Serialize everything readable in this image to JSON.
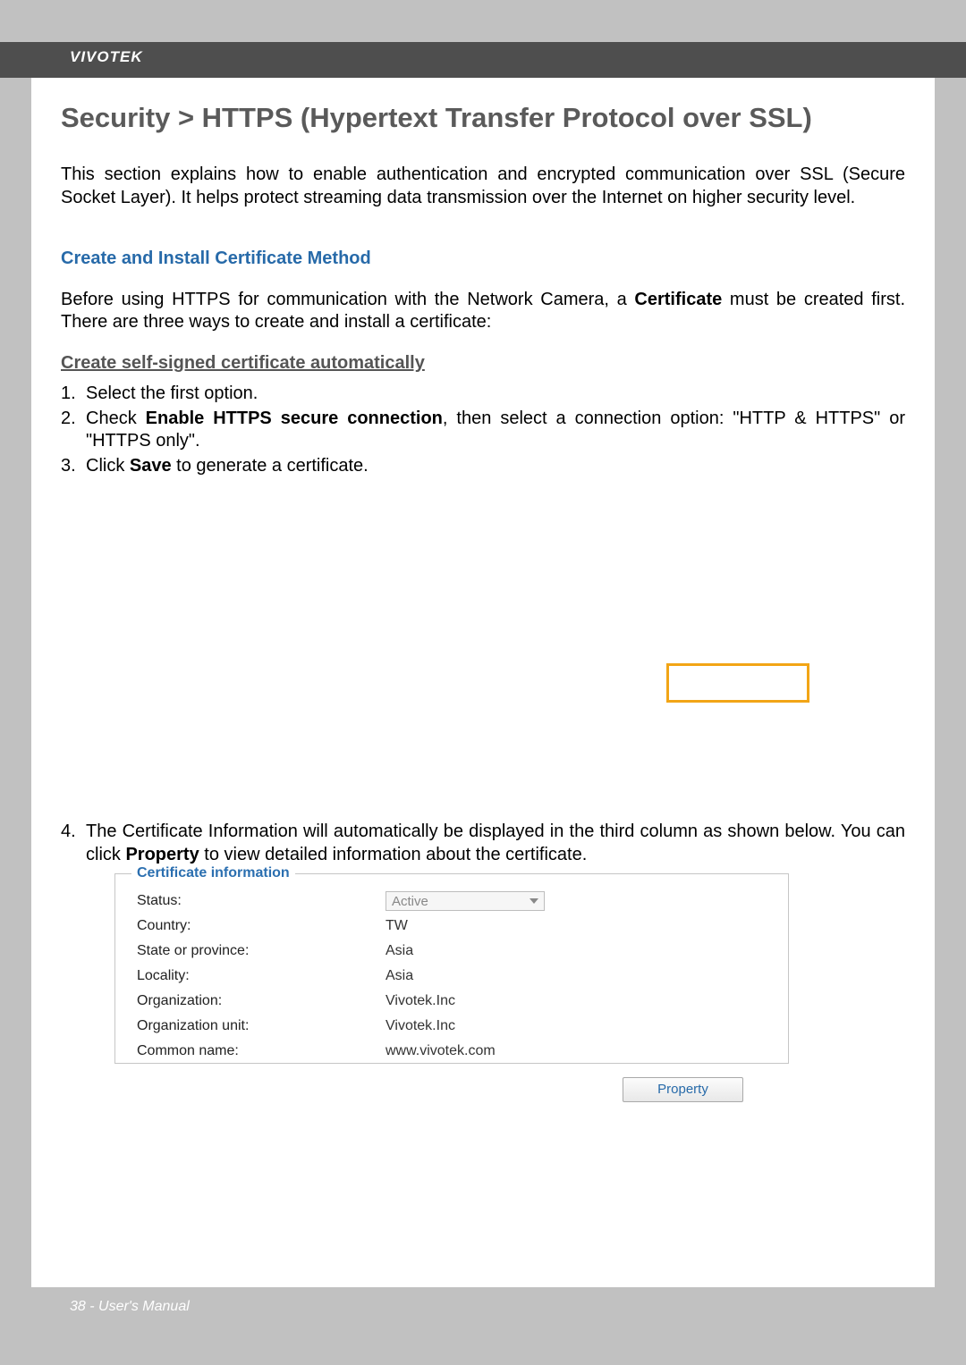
{
  "brand": "VIVOTEK",
  "title": "Security >  HTTPS (Hypertext Transfer Protocol over SSL)",
  "intro": "This section explains how to enable authentication and encrypted communication over SSL (Secure Socket Layer). It helps protect streaming data transmission over the Internet on higher security level.",
  "section_heading": "Create and Install Certificate Method",
  "before": {
    "p1a": "Before using HTTPS for communication with the Network Camera, a ",
    "strong": "Certificate",
    "p1b": " must be created first. There are three ways to create and install a certificate:"
  },
  "subheading": "Create self-signed certificate automatically",
  "steps": [
    {
      "n": "1.",
      "t": "Select the first option."
    },
    {
      "n": "2.",
      "a": "Check ",
      "b": "Enable HTTPS secure connection",
      "c": ", then select a connection option: \"HTTP & HTTPS\" or \"HTTPS only\"."
    },
    {
      "n": "3.",
      "a": "Click ",
      "b": "Save",
      "c": " to generate a certificate."
    }
  ],
  "step4": {
    "n": "4.",
    "a": "The Certificate Information will automatically be displayed in the third column as shown below. You can click ",
    "b": "Property",
    "c": " to view detailed information about the certificate."
  },
  "cert": {
    "legend": "Certificate information",
    "status_label": "Status:",
    "status_value": "Active",
    "rows": [
      {
        "label": "Country:",
        "value": "TW"
      },
      {
        "label": "State or province:",
        "value": "Asia"
      },
      {
        "label": "Locality:",
        "value": "Asia"
      },
      {
        "label": "Organization:",
        "value": "Vivotek.Inc"
      },
      {
        "label": "Organization unit:",
        "value": "Vivotek.Inc"
      },
      {
        "label": "Common name:",
        "value": "www.vivotek.com"
      }
    ]
  },
  "property_button": "Property",
  "footer": "38 - User's Manual"
}
